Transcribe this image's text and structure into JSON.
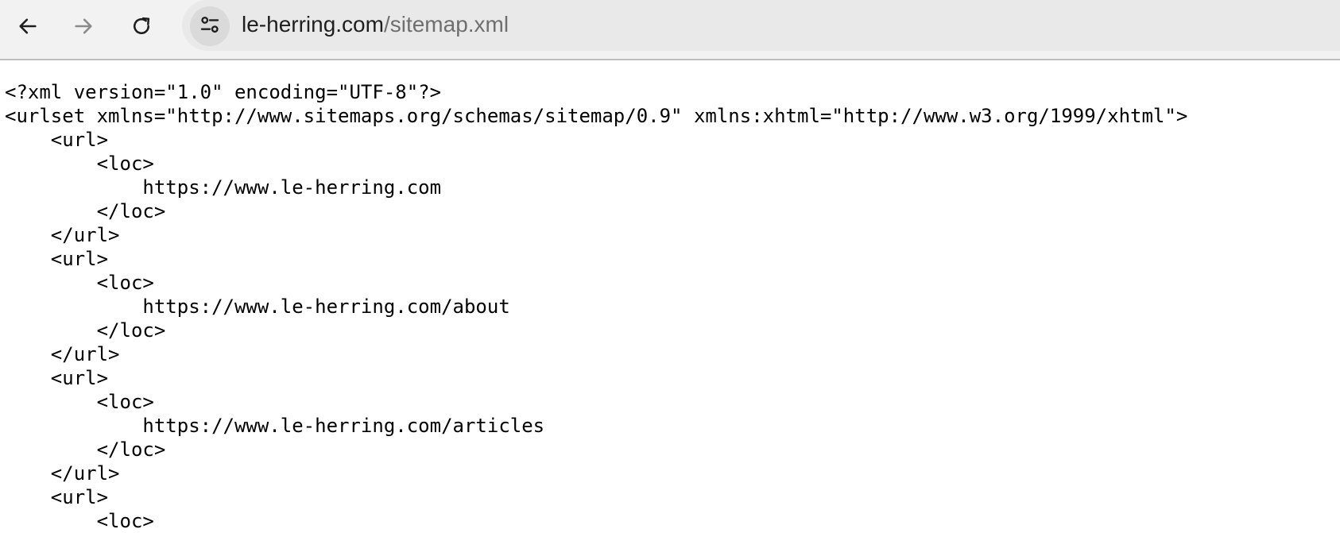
{
  "browser": {
    "url_host": "le-herring.com",
    "url_path": "/sitemap.xml"
  },
  "xml": {
    "lines": [
      "<?xml version=\"1.0\" encoding=\"UTF-8\"?>",
      "<urlset xmlns=\"http://www.sitemaps.org/schemas/sitemap/0.9\" xmlns:xhtml=\"http://www.w3.org/1999/xhtml\">",
      "    <url>",
      "        <loc>",
      "            https://www.le-herring.com",
      "        </loc>",
      "    </url>",
      "    <url>",
      "        <loc>",
      "            https://www.le-herring.com/about",
      "        </loc>",
      "    </url>",
      "    <url>",
      "        <loc>",
      "            https://www.le-herring.com/articles",
      "        </loc>",
      "    </url>",
      "    <url>",
      "        <loc>"
    ]
  }
}
